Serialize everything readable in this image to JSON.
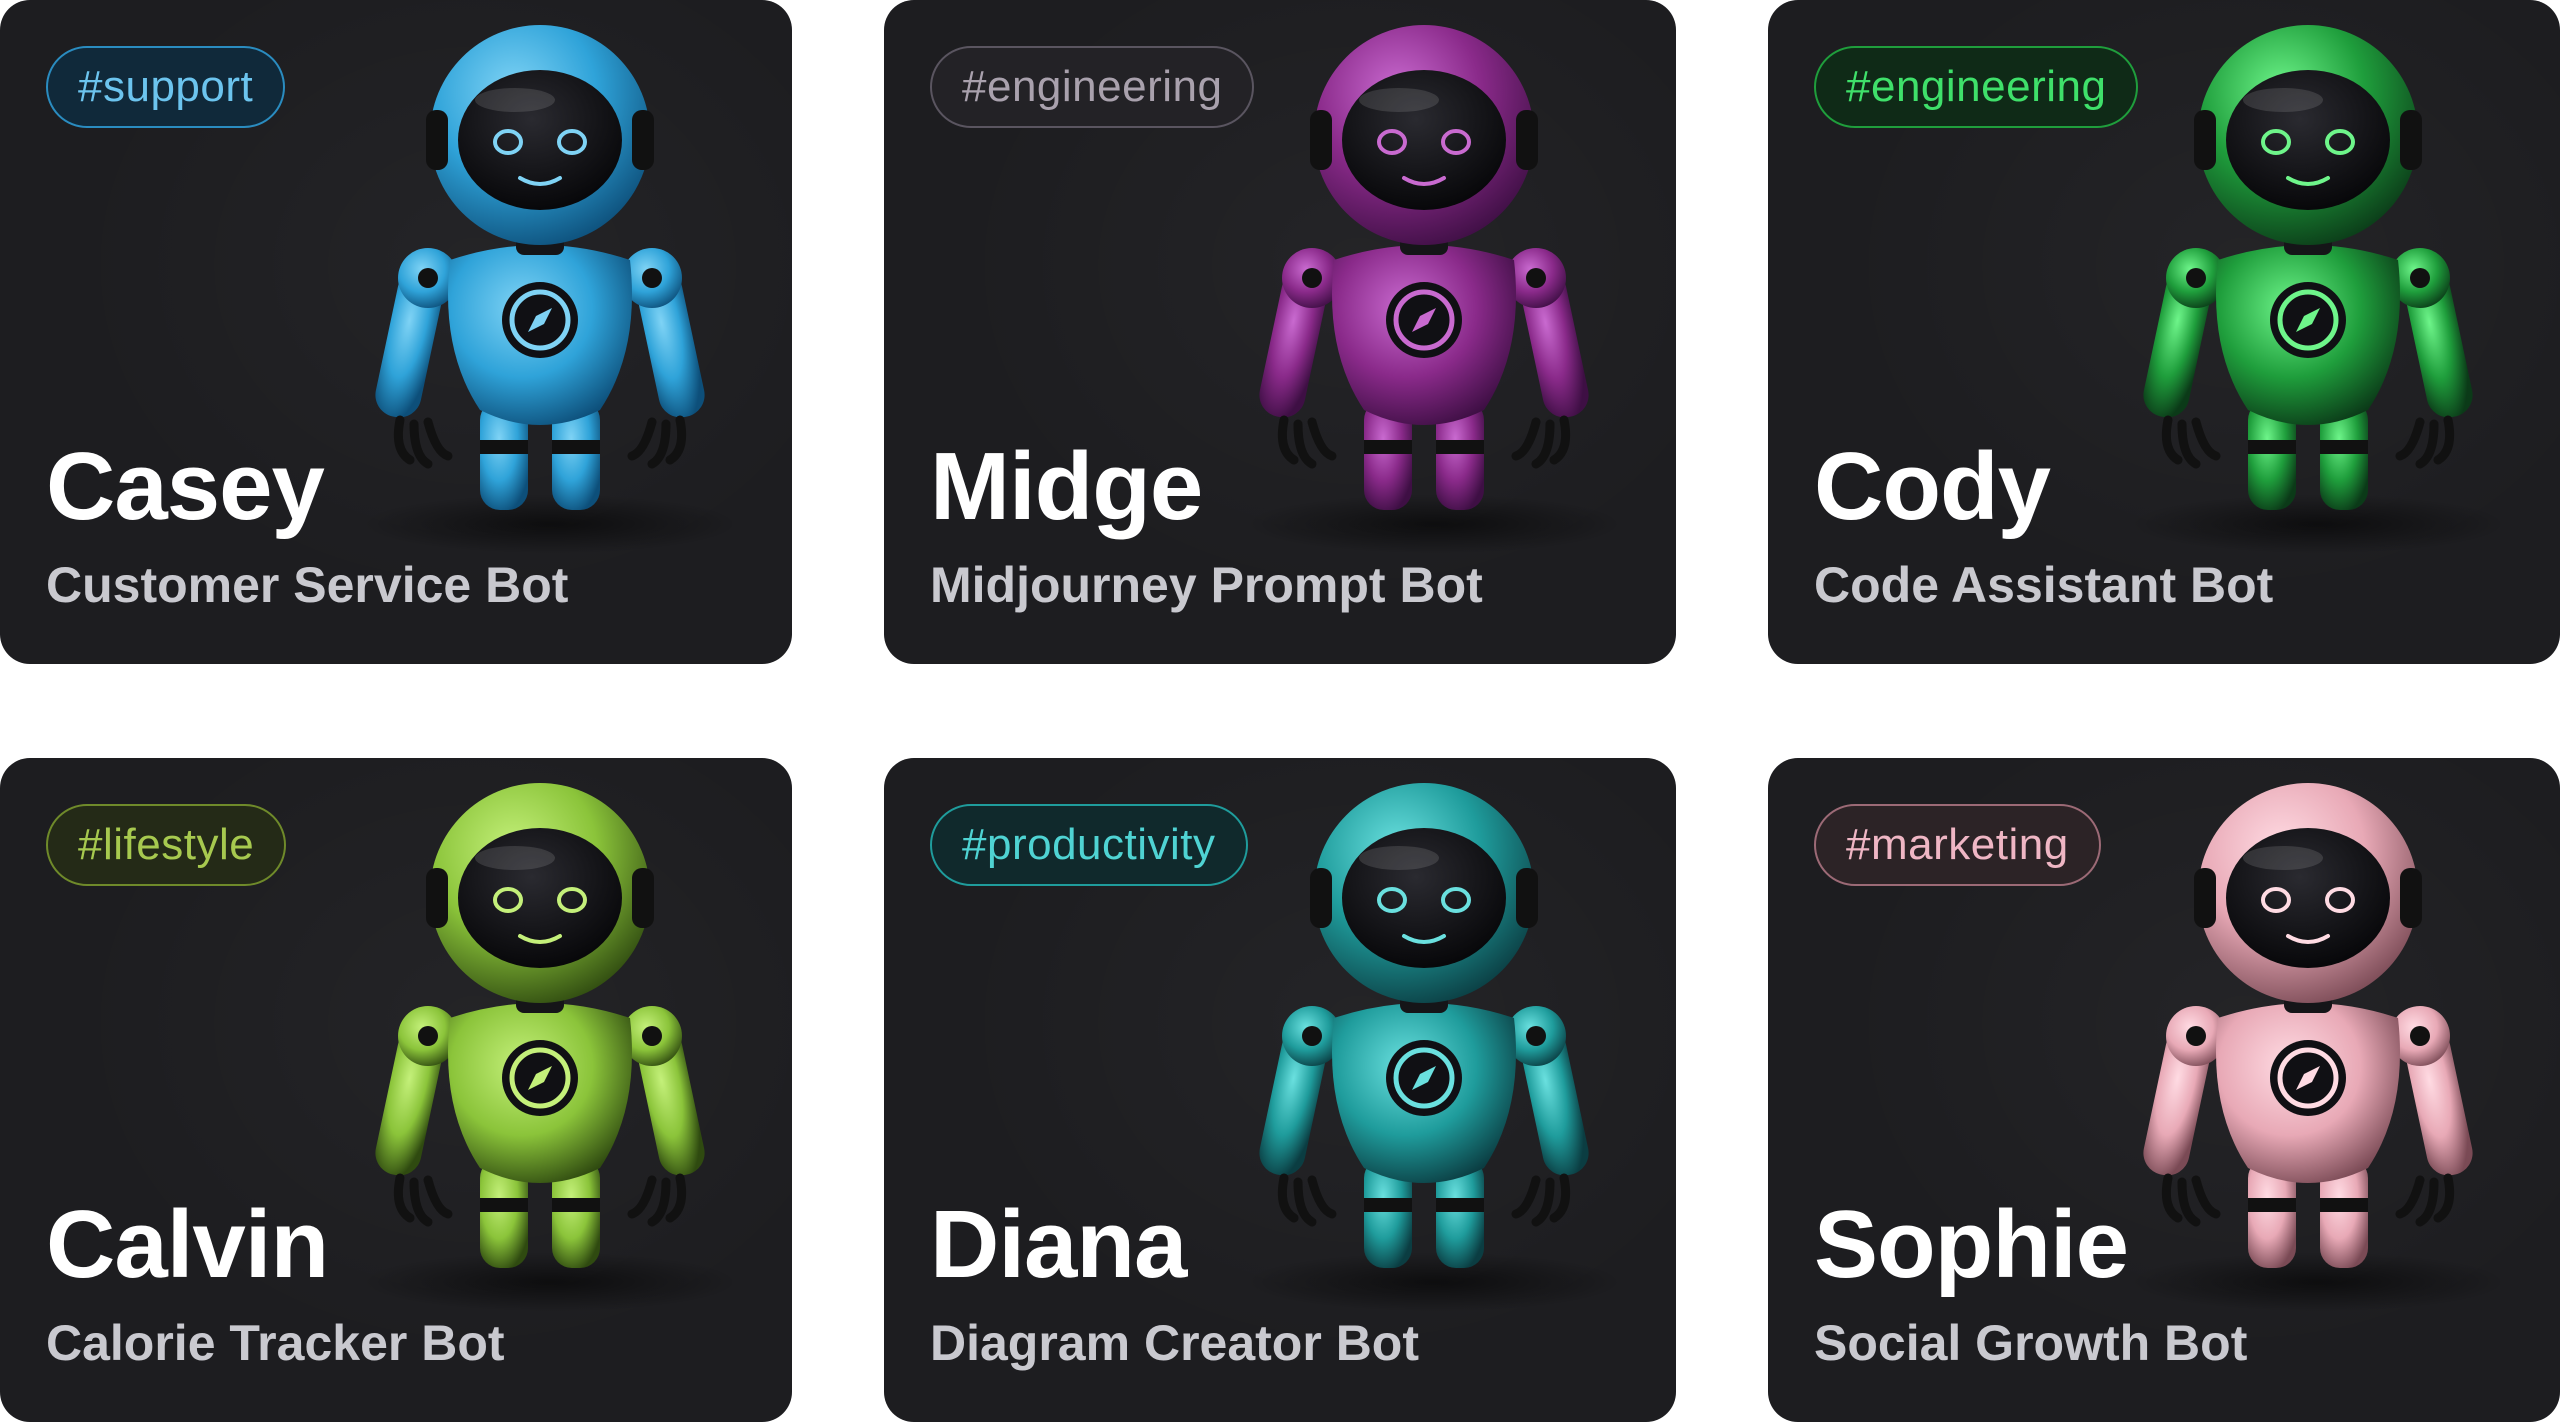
{
  "bots": [
    {
      "tag": "#support",
      "name": "Casey",
      "role": "Customer Service Bot",
      "colors": {
        "main": "#2fa3d9",
        "dark": "#0d4f7a",
        "light": "#7fd3f5",
        "tag_text": "#6cc4ee",
        "tag_border": "#2a8cc0",
        "tag_bg": "#10293a"
      },
      "icon": "compass-icon"
    },
    {
      "tag": "#engineering",
      "name": "Midge",
      "role": "Midjourney Prompt Bot",
      "colors": {
        "main": "#8a2a8a",
        "dark": "#3e0f44",
        "light": "#c96ad0",
        "tag_text": "#a9a1ad",
        "tag_border": "#5a5560",
        "tag_bg": "#232226"
      },
      "icon": "compass-icon"
    },
    {
      "tag": "#engineering",
      "name": "Cody",
      "role": "Code Assistant Bot",
      "colors": {
        "main": "#1f9e3c",
        "dark": "#0b3a18",
        "light": "#6ef58a",
        "tag_text": "#3fe06a",
        "tag_border": "#1f9e3c",
        "tag_bg": "#0f2a17"
      },
      "icon": "compass-icon"
    },
    {
      "tag": "#lifestyle",
      "name": "Calvin",
      "role": "Calorie Tracker Bot",
      "colors": {
        "main": "#8bc43a",
        "dark": "#2f4a10",
        "light": "#c4f07a",
        "tag_text": "#a7c94f",
        "tag_border": "#6f8a2a",
        "tag_bg": "#242a17"
      },
      "icon": "compass-icon"
    },
    {
      "tag": "#productivity",
      "name": "Diana",
      "role": "Diagram Creator Bot",
      "colors": {
        "main": "#1f9c9c",
        "dark": "#0b3d42",
        "light": "#6ae0df",
        "tag_text": "#4fd3d3",
        "tag_border": "#1f9c9c",
        "tag_bg": "#10292c"
      },
      "icon": "compass-icon"
    },
    {
      "tag": "#marketing",
      "name": "Sophie",
      "role": "Social Growth Bot",
      "colors": {
        "main": "#e8a9b6",
        "dark": "#7a4a55",
        "light": "#ffdbe3",
        "tag_text": "#efb6c4",
        "tag_border": "#9c6a76",
        "tag_bg": "#2c2326"
      },
      "icon": "compass-icon"
    }
  ]
}
